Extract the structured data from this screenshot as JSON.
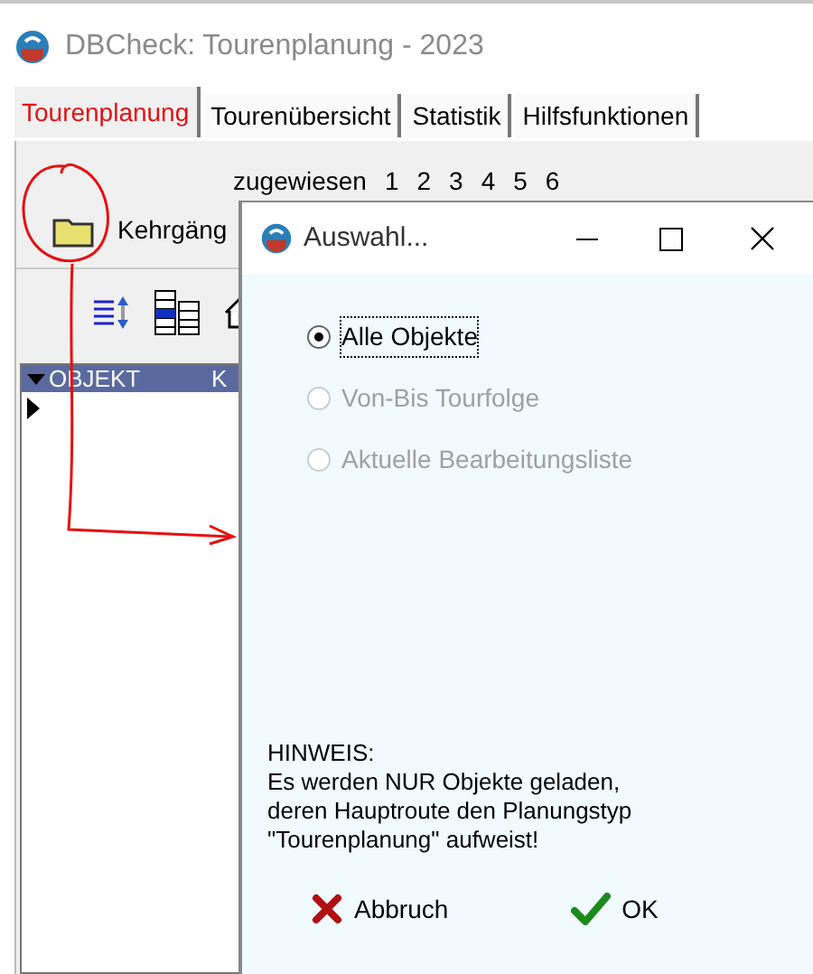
{
  "window": {
    "title": "DBCheck: Tourenplanung - 2023"
  },
  "tabs": [
    {
      "label": "Tourenplanung",
      "selected": true
    },
    {
      "label": "Tourenübersicht",
      "selected": false
    },
    {
      "label": "Statistik",
      "selected": false
    },
    {
      "label": "Hilfsfunktionen",
      "selected": false
    }
  ],
  "toolbar": {
    "label": "zugewiesen",
    "numbers": [
      "1",
      "2",
      "3",
      "4",
      "5",
      "6"
    ],
    "folder_label": "Kehrgäng"
  },
  "grid": {
    "columns": [
      "OBJEKT",
      "K"
    ]
  },
  "dialog": {
    "title": "Auswahl...",
    "options": [
      {
        "label": "Alle Objekte",
        "selected": true,
        "disabled": false
      },
      {
        "label": "Von-Bis Tourfolge",
        "selected": false,
        "disabled": true
      },
      {
        "label": "Aktuelle Bearbeitungsliste",
        "selected": false,
        "disabled": true
      }
    ],
    "note": [
      "HINWEIS:",
      "Es werden NUR Objekte geladen,",
      "deren Hauptroute den Planungstyp",
      "\"Tourenplanung\" aufweist!"
    ],
    "buttons": [
      {
        "label": "Abbruch",
        "kind": "cancel"
      },
      {
        "label": "OK",
        "kind": "ok"
      }
    ]
  }
}
